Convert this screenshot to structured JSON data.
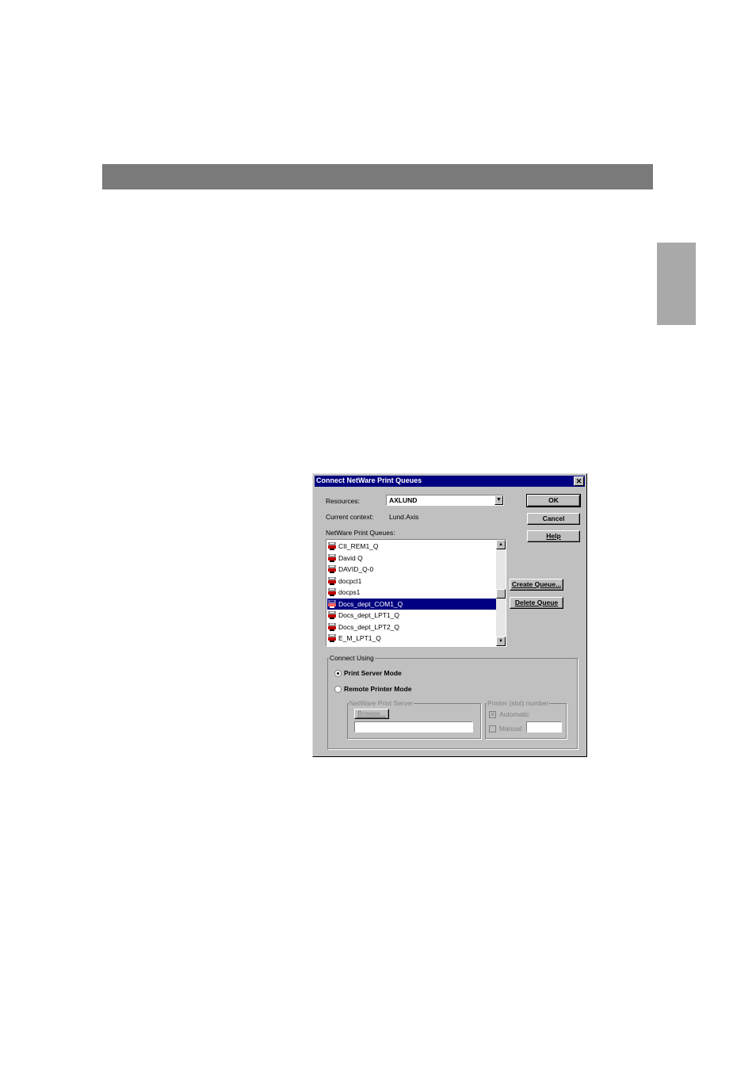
{
  "dialog": {
    "title": "Connect NetWare Print Queues",
    "close_glyph": "✕",
    "resources_label": "Resources:",
    "resources_value": "AXLUND",
    "current_context_label": "Current context:",
    "current_context_value": "Lund.Axis",
    "queues_label": "NetWare Print Queues:",
    "queues": [
      {
        "name": "CII_REM1_Q",
        "icon": "print-queue-icon",
        "selected": false
      },
      {
        "name": "David Q",
        "icon": "print-queue-icon",
        "selected": false
      },
      {
        "name": "DAVID_Q-0",
        "icon": "print-queue-icon",
        "selected": false
      },
      {
        "name": "docpcl1",
        "icon": "print-queue-icon",
        "selected": false
      },
      {
        "name": "docps1",
        "icon": "print-queue-icon",
        "selected": false
      },
      {
        "name": "Docs_dept_COM1_Q",
        "icon": "print-queue-icon",
        "selected": true
      },
      {
        "name": "Docs_dept_LPT1_Q",
        "icon": "print-queue-icon",
        "selected": false
      },
      {
        "name": "Docs_dept_LPT2_Q",
        "icon": "print-queue-icon",
        "selected": false
      },
      {
        "name": "E_M_LPT1_Q",
        "icon": "print-queue-icon",
        "selected": false
      }
    ],
    "buttons": {
      "ok": "OK",
      "cancel": "Cancel",
      "help": "Help",
      "create_queue": "Create Queue...",
      "delete_queue": "Delete Queue",
      "browse": "Browse..."
    },
    "connect_using": {
      "label": "Connect Using",
      "print_server_mode": "Print Server Mode",
      "remote_printer_mode": "Remote Printer Mode",
      "selected_mode": "Print Server Mode",
      "netware_print_server_label": "NetWare Print Server",
      "printer_slot_label": "Printer (slot) number",
      "automatic_label": "Automatic",
      "manual_label": "Manual:",
      "automatic_checked": true,
      "manual_checked": false,
      "print_server_value": "",
      "manual_value": ""
    }
  },
  "colors": {
    "title_bar": "#000080",
    "dialog_face": "#c0c0c0",
    "page_bar": "#7a7a7a",
    "thumb_tab": "#a9a9a9",
    "selection": "#000080"
  }
}
